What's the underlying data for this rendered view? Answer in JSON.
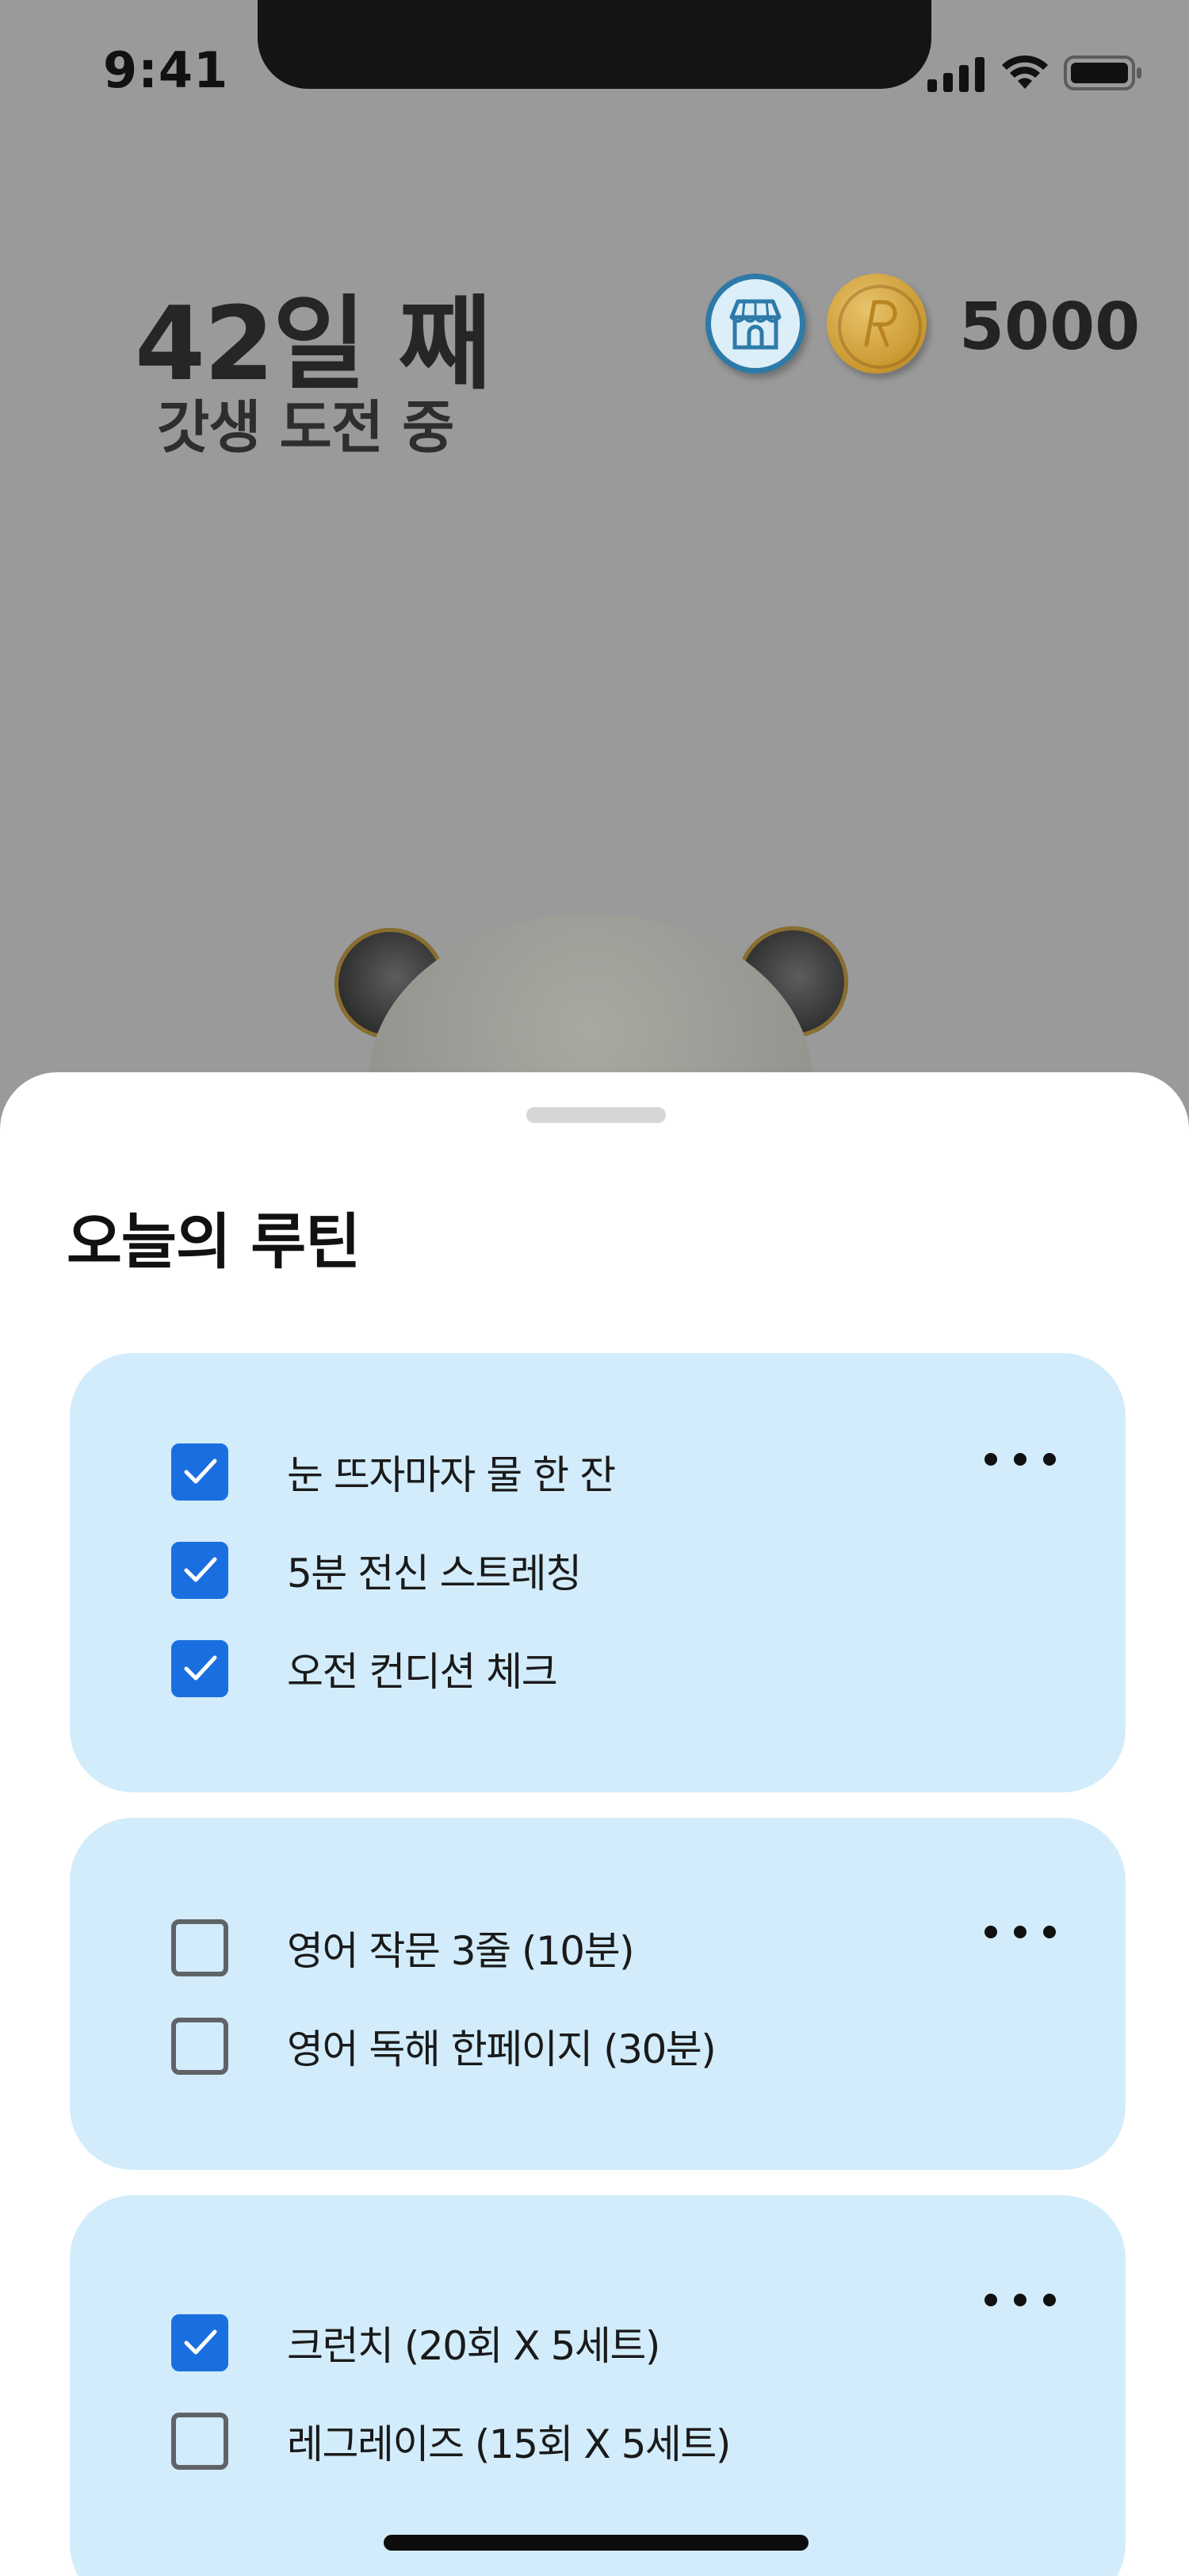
{
  "status_bar": {
    "time": "9:41"
  },
  "header": {
    "day_count": "42일 째",
    "subtitle": "갓생 도전 중",
    "shop_icon": "shop-icon",
    "coin_icon": "coin-icon",
    "coin_balance": "5000"
  },
  "sheet": {
    "title": "오늘의 루틴",
    "routines": [
      {
        "tasks": [
          {
            "label": "눈 뜨자마자 물 한 잔",
            "checked": true
          },
          {
            "label": "5분 전신 스트레칭",
            "checked": true
          },
          {
            "label": "오전 컨디션 체크",
            "checked": true
          }
        ]
      },
      {
        "tasks": [
          {
            "label": "영어 작문 3줄 (10분)",
            "checked": false
          },
          {
            "label": "영어 독해 한페이지 (30분)",
            "checked": false
          }
        ]
      },
      {
        "tasks": [
          {
            "label": "크런치 (20회 X 5세트)",
            "checked": true
          },
          {
            "label": "레그레이즈 (15회 X 5세트)",
            "checked": false
          }
        ]
      }
    ]
  },
  "colors": {
    "overlay": "#9a9a9a",
    "card": "#d2ecfb",
    "checkbox_checked": "#1a6fe0",
    "checkbox_unchecked_border": "#5f6368"
  }
}
